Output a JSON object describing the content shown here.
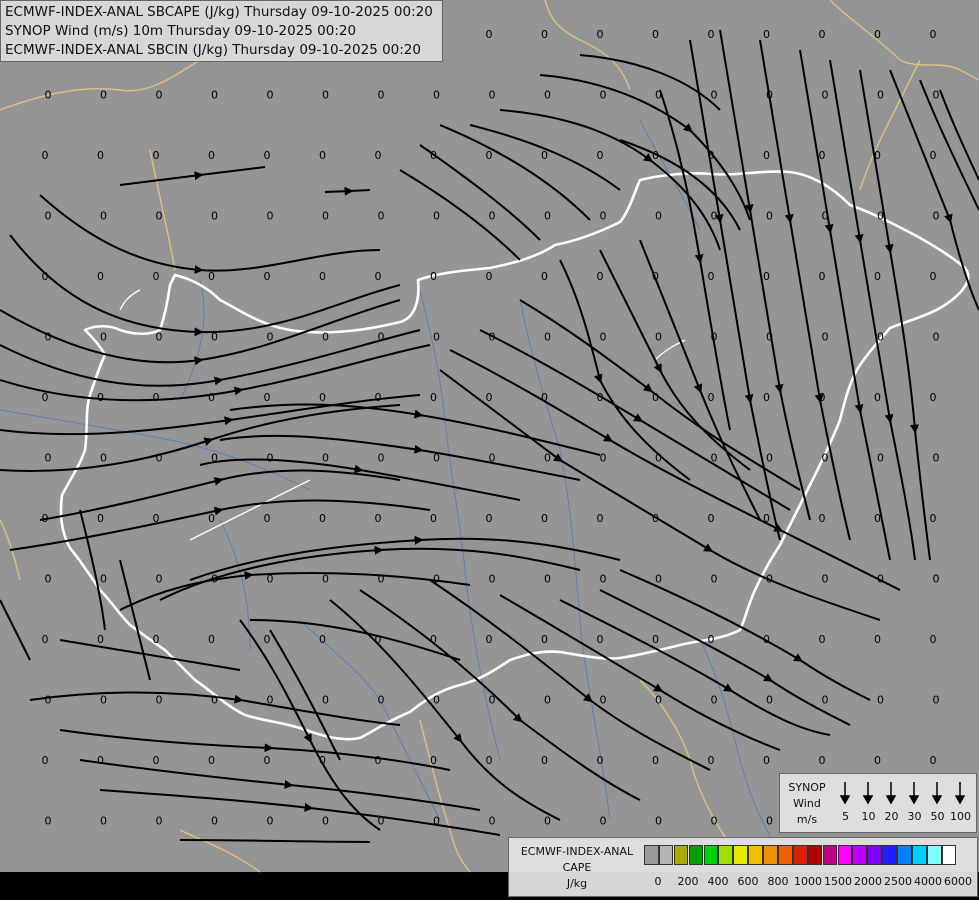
{
  "title_lines": [
    "ECMWF-INDEX-ANAL SBCAPE (J/kg) Thursday 09-10-2025 00:20",
    "SYNOP Wind (m/s) 10m Thursday 09-10-2025 00:20",
    "ECMWF-INDEX-ANAL SBCIN (J/kg) Thursday 09-10-2025 00:20"
  ],
  "cape_value_label": "0",
  "wind_legend": {
    "title_lines": [
      "SYNOP",
      "Wind",
      "m/s"
    ],
    "speeds": [
      "5",
      "10",
      "20",
      "30",
      "50",
      "100"
    ]
  },
  "cape_legend": {
    "title_lines": [
      "ECMWF-INDEX-ANAL",
      "CAPE",
      "J/kg"
    ],
    "ticks": [
      "0",
      "200",
      "400",
      "600",
      "800",
      "1000",
      "1500",
      "2000",
      "2500",
      "4000",
      "6000"
    ],
    "colors": [
      "#9a9a9a",
      "#b4b4b4",
      "#aaaa00",
      "#00a000",
      "#00d000",
      "#a0e000",
      "#e8e800",
      "#f0c000",
      "#f09000",
      "#f06000",
      "#e02000",
      "#b00000",
      "#c00080",
      "#ff00ff",
      "#c000ff",
      "#8000ff",
      "#2020ff",
      "#0080ff",
      "#00d0ff",
      "#80ffff",
      "#ffffff"
    ]
  },
  "colors": {
    "background": "#959595",
    "streamline": "#000000",
    "country_border": "#ffffff",
    "region_border": "#e0c080",
    "river": "#5a7fb0"
  }
}
